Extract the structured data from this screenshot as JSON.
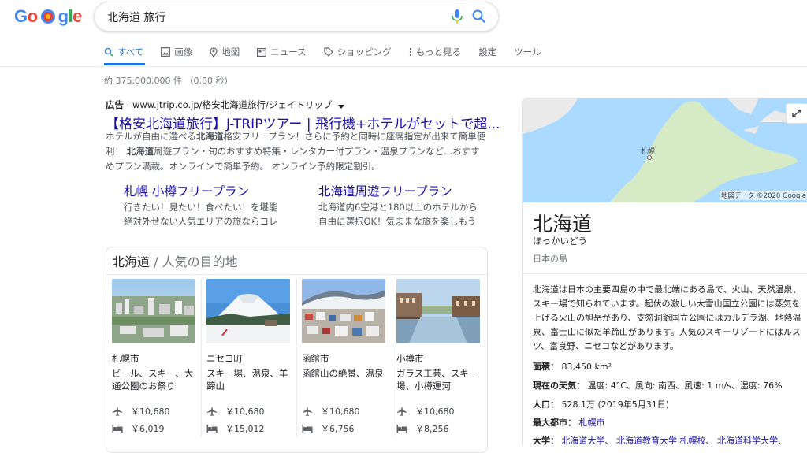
{
  "query": "北海道 旅行",
  "tabs": [
    {
      "label": "すべて",
      "icon": "search-icon"
    },
    {
      "label": "画像",
      "icon": "image-icon"
    },
    {
      "label": "地図",
      "icon": "map-pin-icon"
    },
    {
      "label": "ニュース",
      "icon": "news-icon"
    },
    {
      "label": "ショッピング",
      "icon": "tag-icon"
    },
    {
      "label": "もっと見る",
      "icon": "more-vert-icon"
    },
    {
      "label": "設定"
    },
    {
      "label": "ツール"
    }
  ],
  "result_stats": "約 375,000,000 件 （0.80 秒）",
  "ad": {
    "label": "広告",
    "url": "www.jtrip.co.jp/格安北海道旅行/ジェイトリップ",
    "title": "【格安北海道旅行】J-TRIPツアー | 飛行機+ホテルがセットで超...",
    "desc_parts": [
      "ホテルが自由に選べる",
      "北海道",
      "格安フリープラン！さらに予約と同時に座席指定が出来て簡単便利！ ",
      "北海道",
      "周遊プラン・旬のおすすめ特集・レンタカー付プラン・温泉プランなど...おすすめプラン満載。オンラインで簡単予約。 オンライン予約限定割引。"
    ],
    "sitelinks": [
      {
        "title": "札幌 小樽フリープラン",
        "desc1": "行きたい！見たい！食べたい！を堪能",
        "desc2": "絶対外せない人気エリアの旅ならコレ"
      },
      {
        "title": "北海道周遊フリープラン",
        "desc1": "北海道内6空港と180以上のホテルから",
        "desc2": "自由に選択OK！気ままな旅を楽しもう"
      }
    ]
  },
  "destinations": {
    "title": "北海道",
    "subtitle": "/ 人気の目的地",
    "items": [
      {
        "name": "札幌市",
        "desc": "ビール、スキー、大通公園のお祭り",
        "flight": "￥10,680",
        "hotel": "￥6,019"
      },
      {
        "name": "ニセコ町",
        "desc": "スキー場、温泉、羊蹄山",
        "flight": "￥10,680",
        "hotel": "￥15,012"
      },
      {
        "name": "函館市",
        "desc": "函館山の絶景、温泉",
        "flight": "￥10,680",
        "hotel": "￥6,756"
      },
      {
        "name": "小樽市",
        "desc": "ガラス工芸、スキー場、小樽運河",
        "flight": "￥10,680",
        "hotel": "￥8,256"
      }
    ]
  },
  "knowledge_panel": {
    "map_city_label": "札幌",
    "map_attribution": "地図データ ©2020 Google",
    "title": "北海道",
    "reading": "ほっかいどう",
    "type": "日本の島",
    "description": "北海道は日本の主要四島の中で最北端にある島で、火山、天然温泉、スキー場で知られています。起伏の激しい大雪山国立公園には蒸気を上げる火山の旭岳があり、支笏洞爺国立公園にはカルデラ湖、地熱温泉、富士山に似た羊蹄山があります。人気のスキーリゾートにはルスツ、富良野、ニセコなどがあります。",
    "facts": [
      {
        "label": "面積：",
        "value": "83,450 km²"
      },
      {
        "label": "現在の天気：",
        "value": "温度: 4°C、風向: 南西、風速: 1 m/s、湿度: 76%"
      },
      {
        "label": "人口：",
        "value": "528.1万 (2019年5月31日)"
      },
      {
        "label": "最大都市：",
        "link": "札幌市"
      },
      {
        "label": "大学：",
        "links": [
          "北海道大学",
          "北海道教育大学 札幌校",
          "北海道科学大学"
        ]
      }
    ]
  },
  "colors": {
    "link": "#1a0dab",
    "accent": "#1a73e8",
    "muted": "#70757a"
  }
}
